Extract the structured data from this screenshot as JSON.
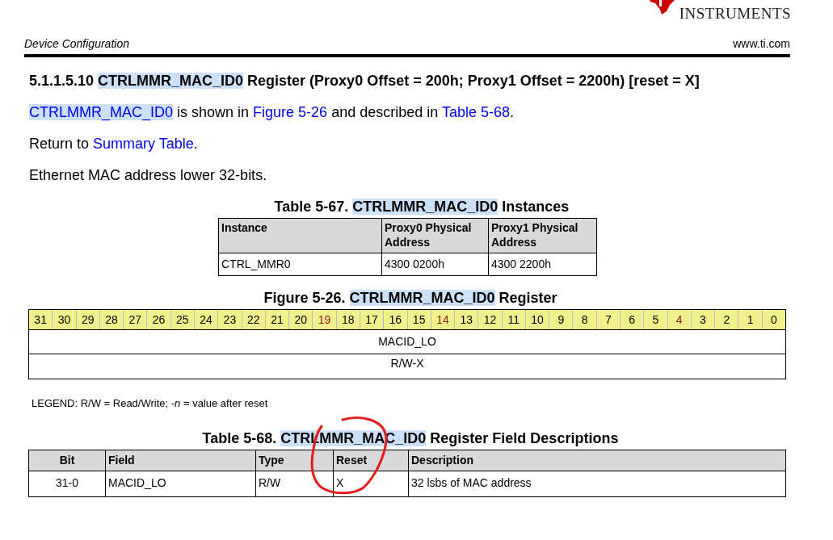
{
  "logo": {
    "line_2": "INSTRUMENTS"
  },
  "header": {
    "section": "Device Configuration",
    "website": "www.ti.com"
  },
  "heading": [
    {
      "text": "5.1.1.5.10 ",
      "highlighted": false
    },
    {
      "text": "CTRLMMR_MAC_ID0",
      "highlighted": true
    },
    {
      "text": " Register (Proxy0 Offset = 200h; Proxy1 Offset = 2200h) [reset = X]",
      "highlighted": false
    }
  ],
  "paragraphs": [
    [
      {
        "kind": "link",
        "text": "CTRLMMR_MAC_ID0",
        "highlighted": true
      },
      {
        "kind": "text",
        "text": " is shown in ",
        "highlighted": false
      },
      {
        "kind": "link",
        "text": "Figure 5-26",
        "highlighted": false
      },
      {
        "kind": "text",
        "text": " and described in ",
        "highlighted": false
      },
      {
        "kind": "link",
        "text": "Table 5-68",
        "highlighted": false
      },
      {
        "kind": "text",
        "text": ".",
        "highlighted": false
      }
    ],
    [
      {
        "kind": "text",
        "text": "Return to ",
        "highlighted": false
      },
      {
        "kind": "link",
        "text": "Summary Table",
        "highlighted": false
      },
      {
        "kind": "text",
        "text": ".",
        "highlighted": false
      }
    ],
    [
      {
        "kind": "text",
        "text": "Ethernet MAC address lower 32-bits.",
        "highlighted": false
      }
    ]
  ],
  "instances_table": {
    "caption": [
      {
        "text": "Table 5-67. ",
        "highlighted": false
      },
      {
        "text": "CTRLMMR_MAC_ID0",
        "highlighted": true
      },
      {
        "text": " Instances",
        "highlighted": false
      }
    ],
    "columns": [
      "Instance",
      "Proxy0 Physical Address",
      "Proxy1 Physical Address"
    ],
    "rows": [
      [
        "CTRL_MMR0",
        "4300 0200h",
        "4300 2200h"
      ]
    ]
  },
  "register_figure": {
    "caption": [
      {
        "text": "Figure 5-26. ",
        "highlighted": false
      },
      {
        "text": "CTRLMMR_MAC_ID0",
        "highlighted": true
      },
      {
        "text": " Register",
        "highlighted": false
      }
    ],
    "bits": [
      {
        "label": "31",
        "kind": "plain"
      },
      {
        "label": "30",
        "kind": "plain"
      },
      {
        "label": "29",
        "kind": "plain"
      },
      {
        "label": "28",
        "kind": "plain"
      },
      {
        "label": "27",
        "kind": "plain"
      },
      {
        "label": "26",
        "kind": "plain"
      },
      {
        "label": "25",
        "kind": "plain"
      },
      {
        "label": "24",
        "kind": "plain"
      },
      {
        "label": "23",
        "kind": "plain"
      },
      {
        "label": "22",
        "kind": "plain"
      },
      {
        "label": "21",
        "kind": "plain"
      },
      {
        "label": "20",
        "kind": "plain"
      },
      {
        "label": "19",
        "kind": "marked"
      },
      {
        "label": "18",
        "kind": "plain"
      },
      {
        "label": "17",
        "kind": "plain"
      },
      {
        "label": "16",
        "kind": "plain"
      },
      {
        "label": "15",
        "kind": "plain"
      },
      {
        "label": "14",
        "kind": "marked"
      },
      {
        "label": "13",
        "kind": "plain"
      },
      {
        "label": "12",
        "kind": "plain"
      },
      {
        "label": "11",
        "kind": "plain"
      },
      {
        "label": "10",
        "kind": "plain"
      },
      {
        "label": "9",
        "kind": "plain"
      },
      {
        "label": "8",
        "kind": "plain"
      },
      {
        "label": "7",
        "kind": "plain"
      },
      {
        "label": "6",
        "kind": "plain"
      },
      {
        "label": "5",
        "kind": "plain"
      },
      {
        "label": "4",
        "kind": "marked"
      },
      {
        "label": "3",
        "kind": "plain"
      },
      {
        "label": "2",
        "kind": "plain"
      },
      {
        "label": "1",
        "kind": "plain"
      },
      {
        "label": "0",
        "kind": "plain"
      }
    ],
    "field_name": "MACID_LO",
    "access": "R/W-X"
  },
  "legend": "LEGEND: R/W = Read/Write; -*n* = value after reset",
  "fields_table": {
    "caption": [
      {
        "text": "Table 5-68. ",
        "highlighted": false
      },
      {
        "text": "CTRLMMR_MAC_ID0",
        "highlighted": true
      },
      {
        "text": " Register Field Descriptions",
        "highlighted": false
      }
    ],
    "columns": [
      "Bit",
      "Field",
      "Type",
      "Reset",
      "Description"
    ],
    "rows": [
      [
        "31-0",
        "MACID_LO",
        "R/W",
        "X",
        "32 lsbs of MAC address"
      ]
    ]
  }
}
